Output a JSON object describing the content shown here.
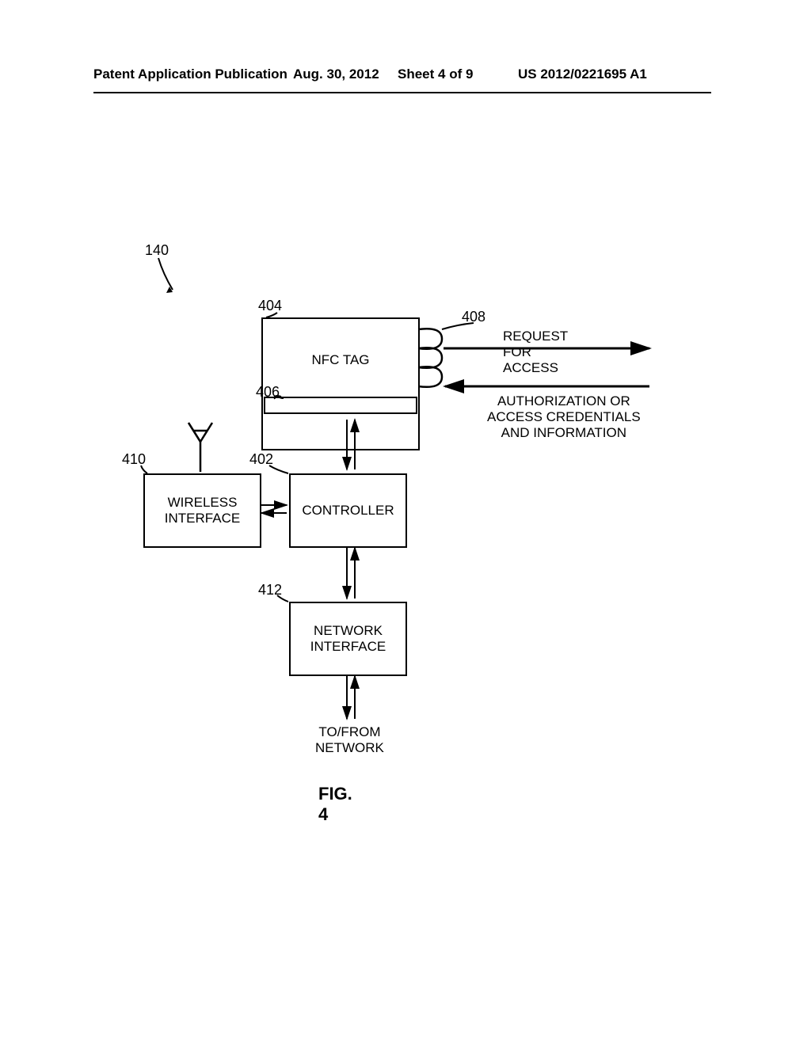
{
  "header": {
    "left": "Patent Application Publication",
    "date": "Aug. 30, 2012",
    "sheet": "Sheet 4 of 9",
    "pubno": "US 2012/0221695 A1"
  },
  "refs": {
    "r140": "140",
    "r404": "404",
    "r406": "406",
    "r408": "408",
    "r410": "410",
    "r402": "402",
    "r412": "412"
  },
  "boxes": {
    "nfc_tag": "NFC TAG",
    "controller": "CONTROLLER",
    "wireless_interface": "WIRELESS\nINTERFACE",
    "network_interface": "NETWORK\nINTERFACE"
  },
  "labels": {
    "request": "REQUEST FOR ACCESS",
    "auth": "AUTHORIZATION OR\nACCESS CREDENTIALS\nAND INFORMATION",
    "tofrom": "TO/FROM\nNETWORK"
  },
  "caption": "FIG. 4"
}
